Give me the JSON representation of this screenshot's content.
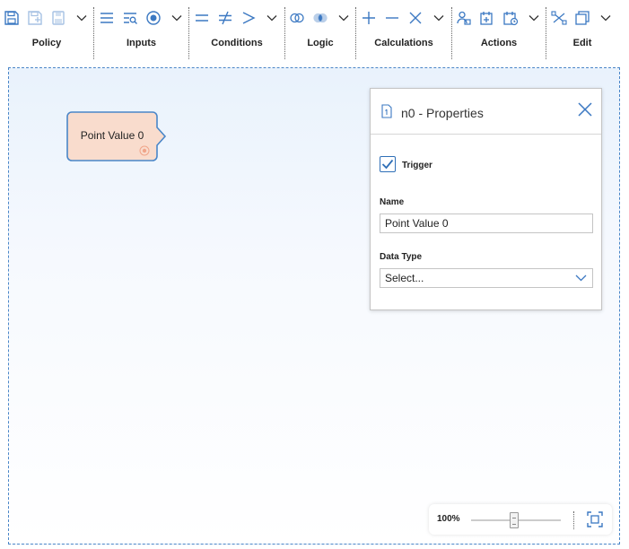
{
  "toolbar": {
    "groups": [
      {
        "label": "Policy",
        "icons": [
          "save-icon",
          "save-as-icon",
          "print-icon",
          "chevron-down-icon"
        ]
      },
      {
        "label": "Inputs",
        "icons": [
          "list-icon",
          "query-icon",
          "point-value-icon",
          "chevron-down-icon"
        ]
      },
      {
        "label": "Conditions",
        "icons": [
          "equal-icon",
          "not-equal-icon",
          "greater-than-icon",
          "chevron-down-icon"
        ]
      },
      {
        "label": "Logic",
        "icons": [
          "and-icon",
          "or-icon",
          "chevron-down-icon"
        ]
      },
      {
        "label": "Calculations",
        "icons": [
          "add-icon",
          "subtract-icon",
          "multiply-icon",
          "chevron-down-icon"
        ]
      },
      {
        "label": "Actions",
        "icons": [
          "user-action-icon",
          "create-event-icon",
          "schedule-icon",
          "chevron-down-icon"
        ]
      },
      {
        "label": "Edit",
        "icons": [
          "connect-icon",
          "copy-icon",
          "chevron-down-icon"
        ]
      }
    ]
  },
  "node": {
    "label": "Point Value 0"
  },
  "properties": {
    "title": "n0 - Properties",
    "trigger_label": "Trigger",
    "trigger_checked": true,
    "name_label": "Name",
    "name_value": "Point Value 0",
    "data_type_label": "Data Type",
    "data_type_value": "Select..."
  },
  "zoom": {
    "percent_label": "100%",
    "level_fraction": 0.48
  },
  "colors": {
    "accent": "#2f6fb7",
    "node_fill": "#f9dccd",
    "node_border": "#4a86c8",
    "canvas_border": "#4a86c8"
  }
}
